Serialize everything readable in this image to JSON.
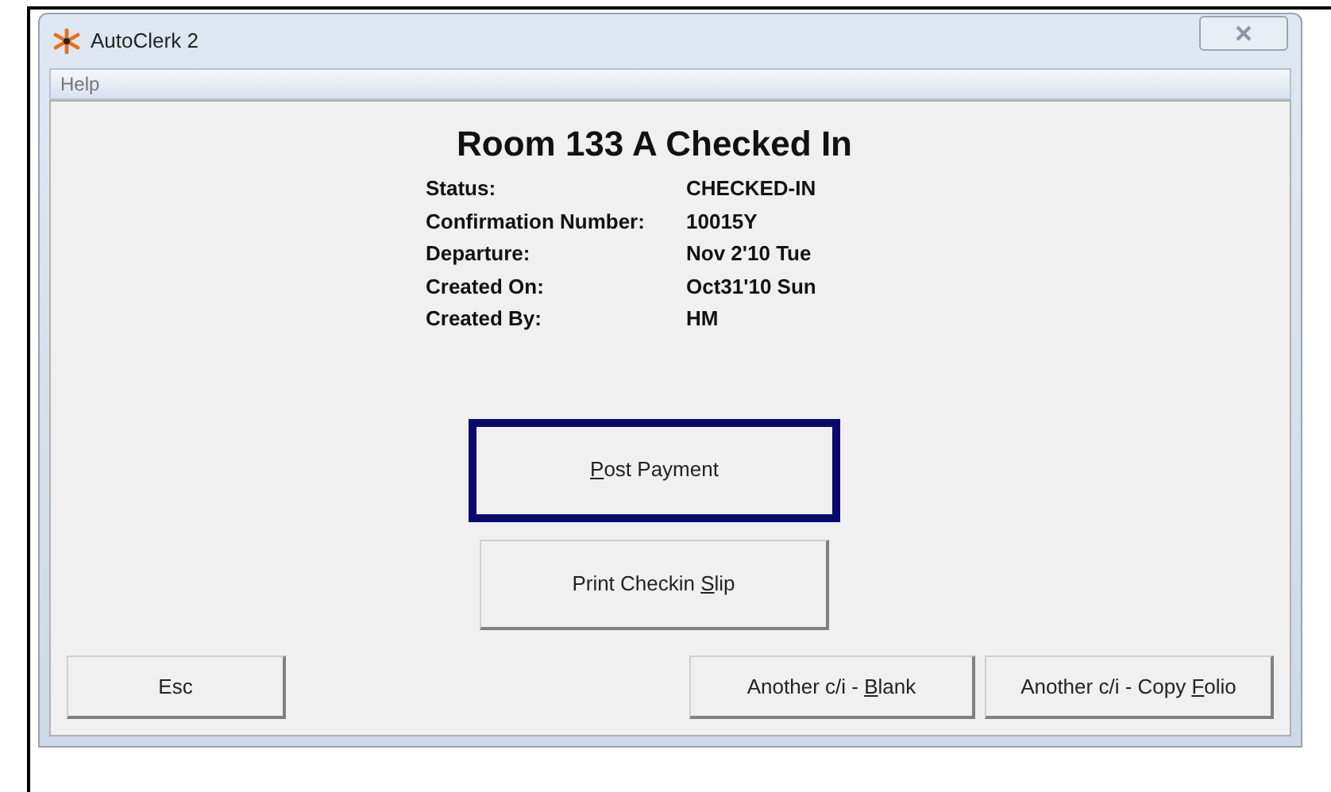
{
  "window": {
    "title": "AutoClerk 2"
  },
  "menu": [
    "Help"
  ],
  "heading": "Room 133 A Checked In",
  "fields": [
    {
      "label": "Status:",
      "value": "CHECKED-IN"
    },
    {
      "label": "Confirmation Number:",
      "value": "10015Y"
    },
    {
      "label": "Departure:",
      "value": "Nov 2'10 Tue"
    },
    {
      "label": "Created On:",
      "value": "Oct31'10 Sun"
    },
    {
      "label": "Created By:",
      "value": "HM"
    }
  ],
  "main_buttons": [
    {
      "key": "P",
      "post": "ost Payment",
      "selected": true
    },
    {
      "pre": "Print Checkin ",
      "key": "S",
      "post": "lip",
      "selected": false
    }
  ],
  "bottom_buttons": [
    {
      "pre": "Esc"
    },
    {
      "pre": "Another c/i - ",
      "key": "B",
      "post": "lank"
    },
    {
      "pre": "Another c/i - Copy ",
      "key": "F",
      "post": "olio"
    }
  ]
}
